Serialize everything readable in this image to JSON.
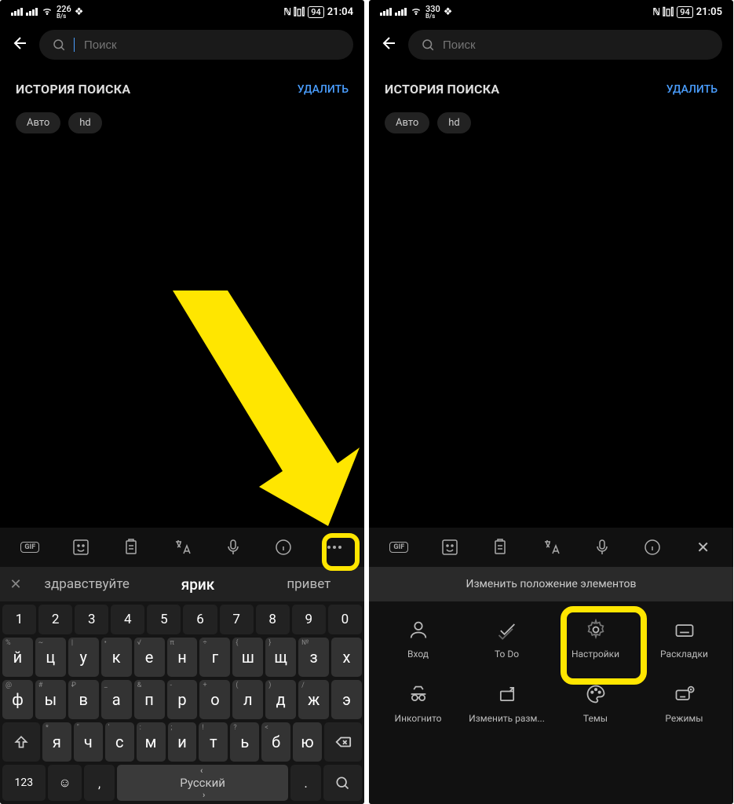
{
  "left": {
    "status": {
      "speed": "226",
      "speed_unit": "B/s",
      "battery": "94",
      "time": "21:04"
    },
    "search": {
      "placeholder": "Поиск"
    },
    "history": {
      "title": "ИСТОРИЯ ПОИСКА",
      "delete": "УДАЛИТЬ",
      "items": [
        "Авто",
        "hd"
      ]
    },
    "toolbar": {
      "gif": "GIF"
    },
    "suggestions": {
      "s1": "здравствуйте",
      "s2": "ярик",
      "s3": "привет"
    },
    "keyboard": {
      "row_num": [
        "1",
        "2",
        "3",
        "4",
        "5",
        "6",
        "7",
        "8",
        "9",
        "0"
      ],
      "row1": [
        "й",
        "ц",
        "у",
        "к",
        "е",
        "н",
        "г",
        "ш",
        "щ",
        "з",
        "х"
      ],
      "row1_alt": [
        "%",
        "~",
        "|",
        "•",
        "√",
        "π",
        "÷",
        "{",
        "}",
        "№",
        ""
      ],
      "row2": [
        "ф",
        "ы",
        "в",
        "а",
        "п",
        "р",
        "о",
        "л",
        "д",
        "ж",
        "э"
      ],
      "row2_alt": [
        "@",
        "#",
        "₽",
        "_",
        "&",
        "-",
        "+",
        "(",
        ")",
        "/",
        ""
      ],
      "row3": [
        "я",
        "ч",
        "с",
        "м",
        "и",
        "т",
        "ь",
        "б",
        "ю"
      ],
      "row3_alt": [
        "*",
        "\"",
        "'",
        ":",
        ";",
        "!",
        "?",
        "<",
        ""
      ],
      "mode": "123",
      "space": "Русский"
    }
  },
  "right": {
    "status": {
      "speed": "330",
      "speed_unit": "B/s",
      "battery": "94",
      "time": "21:05"
    },
    "search": {
      "placeholder": "Поиск"
    },
    "history": {
      "title": "ИСТОРИЯ ПОИСКА",
      "delete": "УДАЛИТЬ",
      "items": [
        "Авто",
        "hd"
      ]
    },
    "toolbar": {
      "gif": "GIF"
    },
    "panel_title": "Изменить положение элементов",
    "options": [
      {
        "label": "Вход"
      },
      {
        "label": "To Do"
      },
      {
        "label": "Настройки"
      },
      {
        "label": "Раскладки"
      },
      {
        "label": "Инкогнито"
      },
      {
        "label": "Изменить разм..."
      },
      {
        "label": "Темы"
      },
      {
        "label": "Режимы"
      }
    ]
  }
}
